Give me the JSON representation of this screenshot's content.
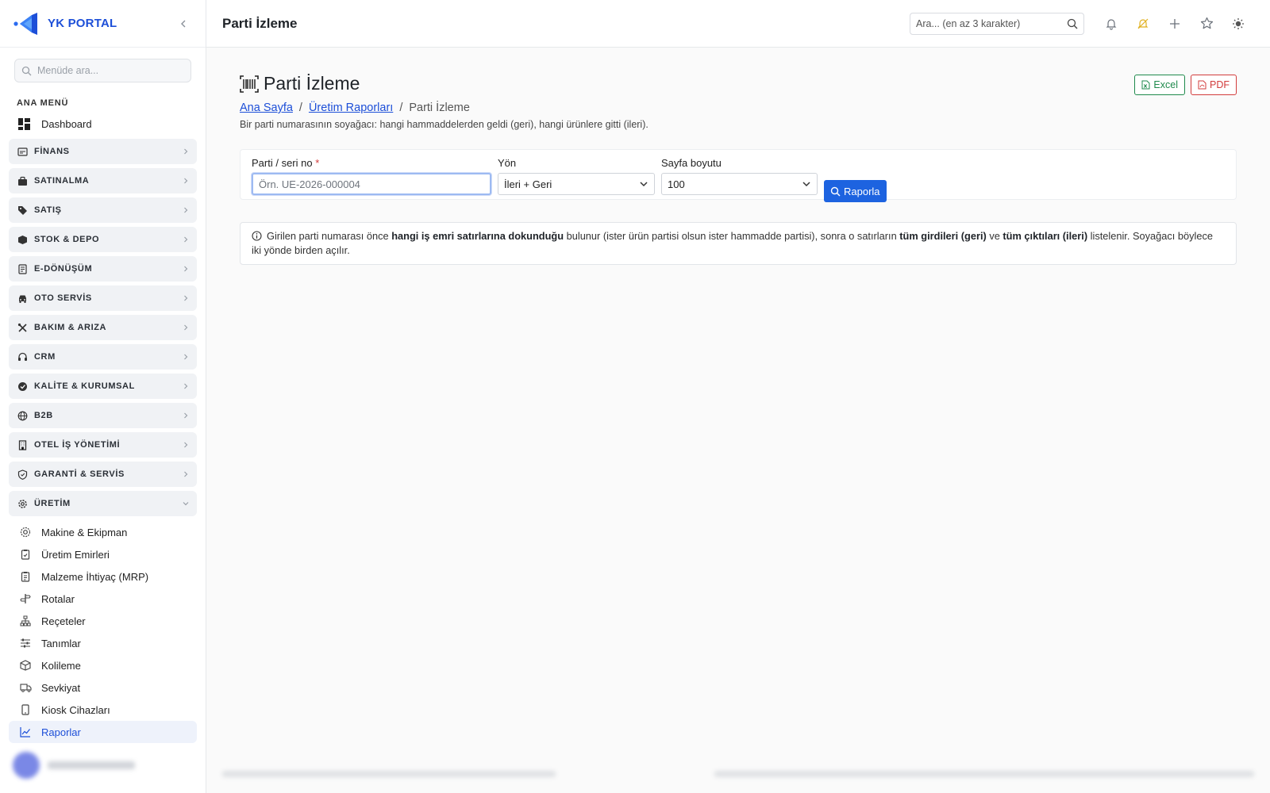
{
  "brand": {
    "name": "YK PORTAL",
    "accent": "#1d4fd8"
  },
  "sidebar": {
    "search_placeholder": "Menüde ara...",
    "section_title": "ANA MENÜ",
    "dashboard": {
      "label": "Dashboard",
      "icon": "dashboard-icon"
    },
    "groups": [
      {
        "label": "FİNANS",
        "icon": "finance-icon"
      },
      {
        "label": "SATINALMA",
        "icon": "purchase-icon"
      },
      {
        "label": "SATIŞ",
        "icon": "tag-icon"
      },
      {
        "label": "STOK & DEPO",
        "icon": "box-icon"
      },
      {
        "label": "E-DÖNÜŞÜM",
        "icon": "document-icon"
      },
      {
        "label": "OTO SERVİS",
        "icon": "car-icon"
      },
      {
        "label": "BAKIM & ARIZA",
        "icon": "tools-icon"
      },
      {
        "label": "CRM",
        "icon": "headset-icon"
      },
      {
        "label": "KALİTE & KURUMSAL",
        "icon": "badge-icon"
      },
      {
        "label": "B2B",
        "icon": "globe-icon"
      },
      {
        "label": "OTEL İŞ YÖNETİMİ",
        "icon": "building-icon"
      },
      {
        "label": "GARANTİ & SERVİS",
        "icon": "shield-icon"
      },
      {
        "label": "ÜRETİM",
        "icon": "gear-icon",
        "expanded": true
      }
    ],
    "production_items": [
      {
        "label": "Makine & Ekipman",
        "icon": "cog-icon"
      },
      {
        "label": "Üretim Emirleri",
        "icon": "clipboard-icon"
      },
      {
        "label": "Malzeme İhtiyaç (MRP)",
        "icon": "clipboard-list-icon"
      },
      {
        "label": "Rotalar",
        "icon": "signpost-icon"
      },
      {
        "label": "Reçeteler",
        "icon": "hierarchy-icon"
      },
      {
        "label": "Tanımlar",
        "icon": "sliders-icon"
      },
      {
        "label": "Kolileme",
        "icon": "package-icon"
      },
      {
        "label": "Sevkiyat",
        "icon": "truck-icon"
      },
      {
        "label": "Kiosk Cihazları",
        "icon": "tablet-icon"
      },
      {
        "label": "Raporlar",
        "icon": "chart-line-icon",
        "active": true
      }
    ]
  },
  "topbar": {
    "title": "Parti İzleme",
    "search_placeholder": "Ara... (en az 3 karakter)"
  },
  "page": {
    "title": "Parti İzleme",
    "breadcrumb": [
      "Ana Sayfa",
      "Üretim Raporları",
      "Parti İzleme"
    ],
    "description": "Bir parti numarasının soyağacı: hangi hammaddelerden geldi (geri), hangi ürünlere gitti (ileri).",
    "export_excel": "Excel",
    "export_pdf": "PDF"
  },
  "filters": {
    "lot_label": "Parti / seri no",
    "lot_required": "*",
    "lot_placeholder": "Örn. UE-2026-000004",
    "direction_label": "Yön",
    "direction_value": "İleri + Geri",
    "page_size_label": "Sayfa boyutu",
    "page_size_value": "100",
    "report_button": "Raporla"
  },
  "info": {
    "p1": "Girilen parti numarası önce ",
    "b1": "hangi iş emri satırlarına dokunduğu",
    "p2": " bulunur (ister ürün partisi olsun ister hammadde partisi), sonra o satırların ",
    "b2": "tüm girdileri (geri)",
    "p3": " ve ",
    "b3": "tüm çıktıları (ileri)",
    "p4": " listelenir. Soyağacı böylece iki yönde birden açılır."
  },
  "colors": {
    "primary": "#1d63e0",
    "excel": "#1f8a4c",
    "pdf": "#d23c3c"
  }
}
